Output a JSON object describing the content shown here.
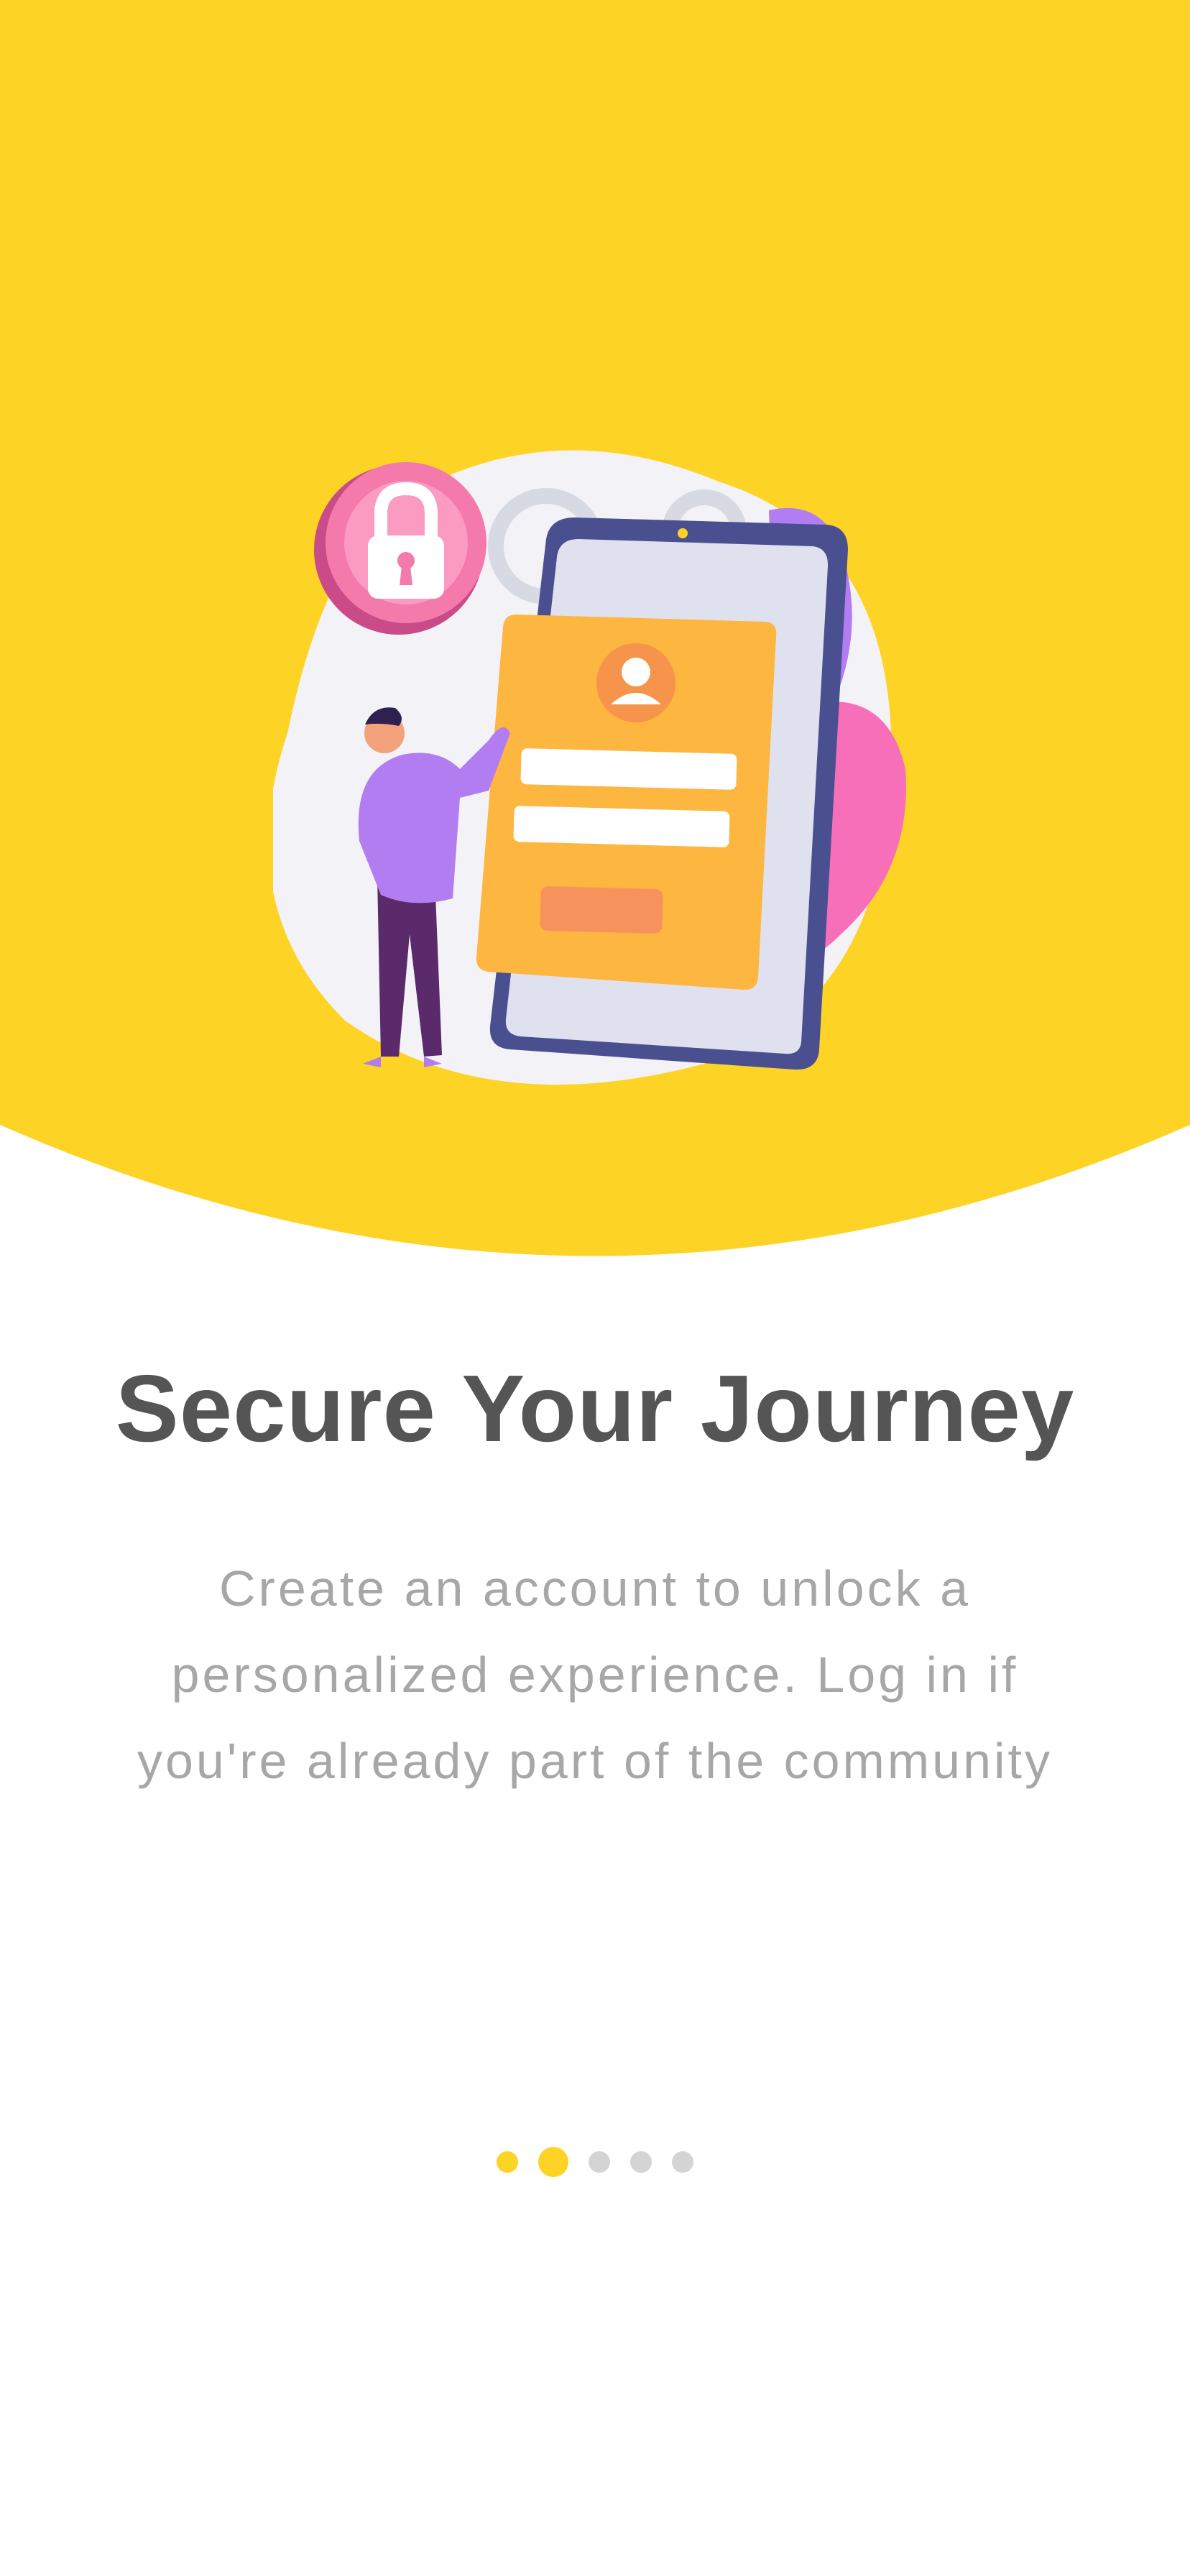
{
  "onboarding": {
    "title": "Secure Your Journey",
    "subtitle_lines": [
      "Create an account to unlock a",
      "personalized experience. Log in if",
      "you're already part of the community"
    ]
  },
  "pager": {
    "total": 5,
    "current_index": 1
  },
  "colors": {
    "accent": "#fdd426",
    "title": "#555555",
    "subtitle": "#a7a7a7",
    "dot_inactive": "#d4d4d4"
  },
  "illustration": {
    "icon": "secure-login-illustration"
  }
}
